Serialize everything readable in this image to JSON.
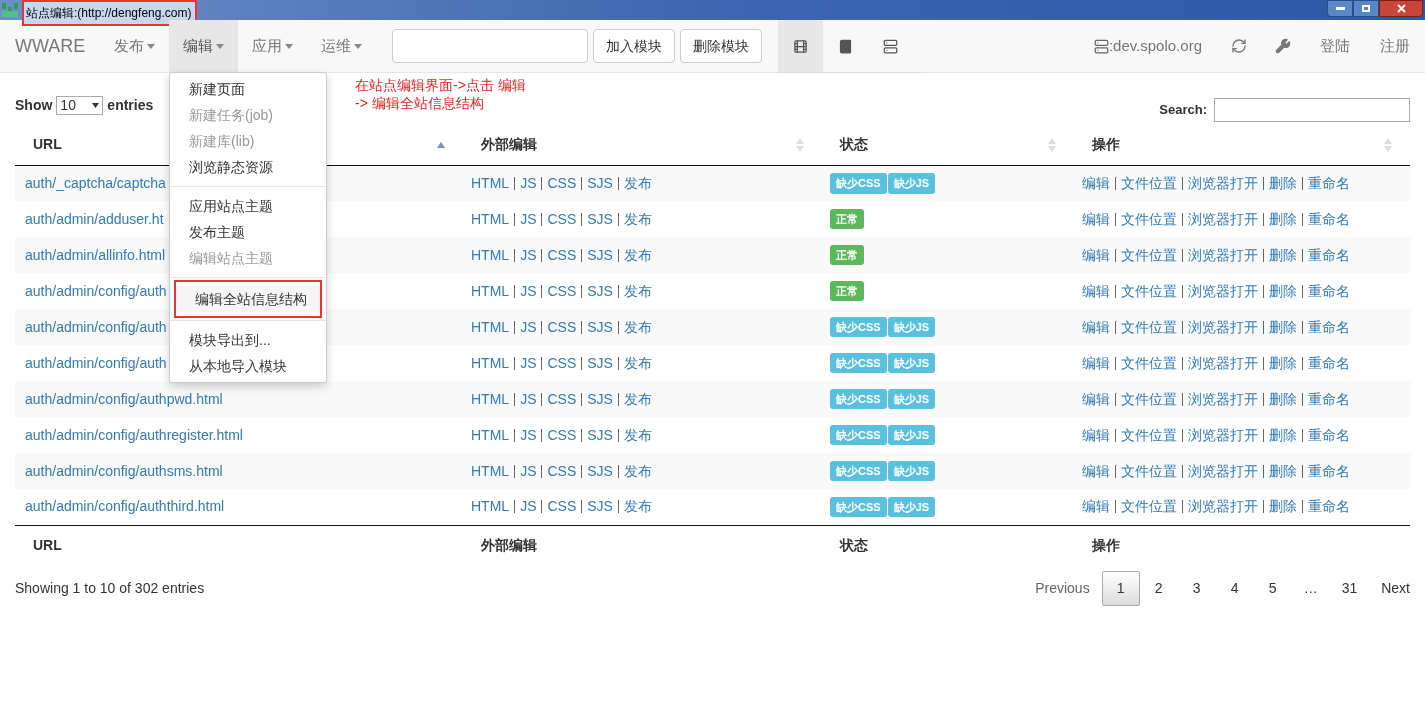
{
  "window": {
    "title": "站点编辑:(http://dengfeng.com)"
  },
  "navbar": {
    "brand": "WWARE",
    "menus": [
      {
        "label": "发布",
        "selected": false
      },
      {
        "label": "编辑",
        "selected": true
      },
      {
        "label": "应用",
        "selected": false
      },
      {
        "label": "运维",
        "selected": false
      }
    ],
    "buttons": [
      "加入模块",
      "删除模块"
    ],
    "view_tabs": [
      {
        "kind": "film",
        "selected": true
      },
      {
        "kind": "book",
        "selected": false
      },
      {
        "kind": "list",
        "selected": false
      }
    ],
    "server": ":dev.spolo.org",
    "links": [
      "登陆",
      "注册"
    ]
  },
  "dropdown": {
    "groups": [
      [
        {
          "label": "新建页面",
          "disabled": false,
          "selected": false
        },
        {
          "label": "新建任务(job)",
          "disabled": true,
          "selected": false
        },
        {
          "label": "新建库(lib)",
          "disabled": true,
          "selected": false
        },
        {
          "label": "浏览静态资源",
          "disabled": false,
          "selected": false
        }
      ],
      [
        {
          "label": "应用站点主题",
          "disabled": false,
          "selected": false
        },
        {
          "label": "发布主题",
          "disabled": false,
          "selected": false
        },
        {
          "label": "编辑站点主题",
          "disabled": true,
          "selected": false
        }
      ],
      [
        {
          "label": "编辑全站信息结构",
          "disabled": false,
          "selected": true
        }
      ],
      [
        {
          "label": "模块导出到...",
          "disabled": false,
          "selected": false
        },
        {
          "label": "从本地导入模块",
          "disabled": false,
          "selected": false
        }
      ]
    ]
  },
  "annotation": {
    "lines": [
      "在站点编辑界面->点击 编辑",
      "-> 编辑全站信息结构"
    ]
  },
  "table": {
    "show_label": "Show",
    "length": "10",
    "entries_label": "entries",
    "search_label": "Search:",
    "columns": [
      {
        "label": "URL",
        "sorted": true
      },
      {
        "label": "外部编辑",
        "sorted": false
      },
      {
        "label": "状态",
        "sorted": false
      },
      {
        "label": "操作",
        "sorted": false
      }
    ],
    "rows": [
      {
        "url": "auth/_captcha/captcha",
        "links": [
          "HTML",
          "JS",
          "CSS",
          "SJS",
          "发布"
        ],
        "statuses": [
          {
            "label": "缺少CSS",
            "color": "#5bc0de"
          },
          {
            "label": "缺少JS",
            "color": "#5bc0de"
          }
        ],
        "actions": [
          "编辑",
          "文件位置",
          "浏览器打开",
          "删除",
          "重命名"
        ]
      },
      {
        "url": "auth/admin/adduser.ht",
        "links": [
          "HTML",
          "JS",
          "CSS",
          "SJS",
          "发布"
        ],
        "statuses": [
          {
            "label": "正常",
            "color": "#5cb85c"
          }
        ],
        "actions": [
          "编辑",
          "文件位置",
          "浏览器打开",
          "删除",
          "重命名"
        ]
      },
      {
        "url": "auth/admin/allinfo.html",
        "links": [
          "HTML",
          "JS",
          "CSS",
          "SJS",
          "发布"
        ],
        "statuses": [
          {
            "label": "正常",
            "color": "#5cb85c"
          }
        ],
        "actions": [
          "编辑",
          "文件位置",
          "浏览器打开",
          "删除",
          "重命名"
        ]
      },
      {
        "url": "auth/admin/config/auth",
        "links": [
          "HTML",
          "JS",
          "CSS",
          "SJS",
          "发布"
        ],
        "statuses": [
          {
            "label": "正常",
            "color": "#5cb85c"
          }
        ],
        "actions": [
          "编辑",
          "文件位置",
          "浏览器打开",
          "删除",
          "重命名"
        ]
      },
      {
        "url": "auth/admin/config/auth",
        "links": [
          "HTML",
          "JS",
          "CSS",
          "SJS",
          "发布"
        ],
        "statuses": [
          {
            "label": "缺少CSS",
            "color": "#5bc0de"
          },
          {
            "label": "缺少JS",
            "color": "#5bc0de"
          }
        ],
        "actions": [
          "编辑",
          "文件位置",
          "浏览器打开",
          "删除",
          "重命名"
        ]
      },
      {
        "url": "auth/admin/config/auth",
        "links": [
          "HTML",
          "JS",
          "CSS",
          "SJS",
          "发布"
        ],
        "statuses": [
          {
            "label": "缺少CSS",
            "color": "#5bc0de"
          },
          {
            "label": "缺少JS",
            "color": "#5bc0de"
          }
        ],
        "actions": [
          "编辑",
          "文件位置",
          "浏览器打开",
          "删除",
          "重命名"
        ]
      },
      {
        "url": "auth/admin/config/authpwd.html",
        "links": [
          "HTML",
          "JS",
          "CSS",
          "SJS",
          "发布"
        ],
        "statuses": [
          {
            "label": "缺少CSS",
            "color": "#5bc0de"
          },
          {
            "label": "缺少JS",
            "color": "#5bc0de"
          }
        ],
        "actions": [
          "编辑",
          "文件位置",
          "浏览器打开",
          "删除",
          "重命名"
        ]
      },
      {
        "url": "auth/admin/config/authregister.html",
        "links": [
          "HTML",
          "JS",
          "CSS",
          "SJS",
          "发布"
        ],
        "statuses": [
          {
            "label": "缺少CSS",
            "color": "#5bc0de"
          },
          {
            "label": "缺少JS",
            "color": "#5bc0de"
          }
        ],
        "actions": [
          "编辑",
          "文件位置",
          "浏览器打开",
          "删除",
          "重命名"
        ]
      },
      {
        "url": "auth/admin/config/authsms.html",
        "links": [
          "HTML",
          "JS",
          "CSS",
          "SJS",
          "发布"
        ],
        "statuses": [
          {
            "label": "缺少CSS",
            "color": "#5bc0de"
          },
          {
            "label": "缺少JS",
            "color": "#5bc0de"
          }
        ],
        "actions": [
          "编辑",
          "文件位置",
          "浏览器打开",
          "删除",
          "重命名"
        ]
      },
      {
        "url": "auth/admin/config/auththird.html",
        "links": [
          "HTML",
          "JS",
          "CSS",
          "SJS",
          "发布"
        ],
        "statuses": [
          {
            "label": "缺少CSS",
            "color": "#5bc0de"
          },
          {
            "label": "缺少JS",
            "color": "#5bc0de"
          }
        ],
        "actions": [
          "编辑",
          "文件位置",
          "浏览器打开",
          "删除",
          "重命名"
        ]
      }
    ],
    "footer_columns": [
      "URL",
      "外部编辑",
      "状态",
      "操作"
    ],
    "info": "Showing 1 to 10 of 302 entries",
    "pagination": {
      "previous": "Previous",
      "pages": [
        {
          "label": "1",
          "selected": true
        },
        {
          "label": "2",
          "selected": false
        },
        {
          "label": "3",
          "selected": false
        },
        {
          "label": "4",
          "selected": false
        },
        {
          "label": "5",
          "selected": false
        },
        {
          "label": "…",
          "selected": false
        },
        {
          "label": "31",
          "selected": false
        }
      ],
      "next": "Next"
    }
  }
}
